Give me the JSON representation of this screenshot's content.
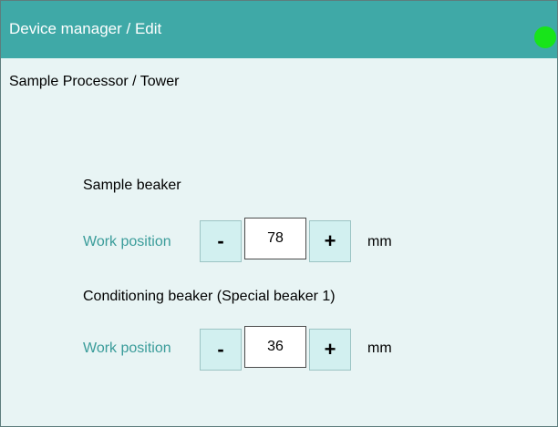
{
  "window": {
    "title": "Device manager / Edit",
    "status_color": "#18e41a"
  },
  "page": {
    "subtitle": "Sample Processor / Tower"
  },
  "sample_beaker": {
    "heading": "Sample beaker",
    "field_label": "Work position",
    "decrement_label": "-",
    "value": "78",
    "increment_label": "+",
    "unit": "mm"
  },
  "conditioning_beaker": {
    "heading": "Conditioning beaker (Special beaker 1)",
    "field_label": "Work position",
    "decrement_label": "-",
    "value": "36",
    "increment_label": "+",
    "unit": "mm"
  }
}
